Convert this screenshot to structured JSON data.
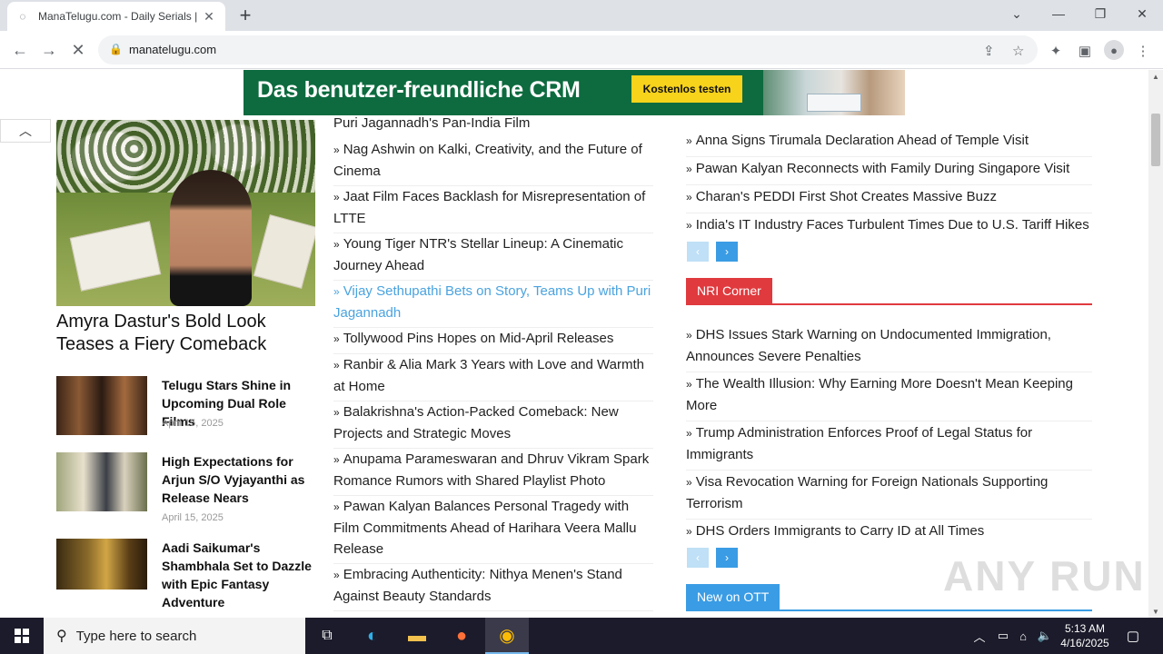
{
  "browser": {
    "tab_title": "ManaTelugu.com - Daily Serials |",
    "url": "manatelugu.com"
  },
  "ad": {
    "headline": "Das benutzer-freundliche CRM",
    "cta": "Kostenlos testen"
  },
  "left": {
    "hero_title": "Amyra Dastur's Bold Look Teases a Fiery Comeback",
    "items": [
      {
        "title": "Telugu Stars Shine in Upcoming Dual Role Films",
        "date": "April 15, 2025"
      },
      {
        "title": "High Expectations for Arjun S/O Vyjayanthi as Release Nears",
        "date": "April 15, 2025"
      },
      {
        "title": "Aadi Saikumar's Shambhala Set to Dazzle with Epic Fantasy Adventure",
        "date": ""
      }
    ]
  },
  "middle": {
    "items": [
      "Puri Jagannadh's Pan-India Film",
      "Nag Ashwin on Kalki, Creativity, and the Future of Cinema",
      "Jaat Film Faces Backlash for Misrepresentation of LTTE",
      "Young Tiger NTR's Stellar Lineup: A Cinematic Journey Ahead",
      "Vijay Sethupathi Bets on Story, Teams Up with Puri Jagannadh",
      "Tollywood Pins Hopes on Mid-April Releases",
      "Ranbir & Alia Mark 3 Years with Love and Warmth at Home",
      "Balakrishna's Action-Packed Comeback: New Projects and Strategic Moves",
      "Anupama Parameswaran and Dhruv Vikram Spark Romance Rumors with Shared Playlist Photo",
      "Pawan Kalyan Balances Personal Tragedy with Film Commitments Ahead of Harihara Veera Mallu Release",
      "Embracing Authenticity: Nithya Menen's Stand Against Beauty Standards"
    ]
  },
  "right": {
    "top_items": [
      "Anna Signs Tirumala Declaration Ahead of Temple Visit",
      "Pawan Kalyan Reconnects with Family During Singapore Visit",
      "Charan's PEDDI First Shot Creates Massive Buzz",
      "India's IT Industry Faces Turbulent Times Due to U.S. Tariff Hikes"
    ],
    "nri_label": "NRI Corner",
    "nri_items": [
      "DHS Issues Stark Warning on Undocumented Immigration, Announces Severe Penalties",
      "The Wealth Illusion: Why Earning More Doesn't Mean Keeping More",
      "Trump Administration Enforces Proof of Legal Status for Immigrants",
      "Visa Revocation Warning for Foreign Nationals Supporting Terrorism",
      "DHS Orders Immigrants to Carry ID at All Times"
    ],
    "ott_label": "New on OTT"
  },
  "colors": {
    "nri": "#e03a3e",
    "ott": "#3a9ce4",
    "link_active": "#4aa3df"
  },
  "watermark": "ANY RUN",
  "taskbar": {
    "search_placeholder": "Type here to search",
    "time": "5:13 AM",
    "date": "4/16/2025"
  }
}
